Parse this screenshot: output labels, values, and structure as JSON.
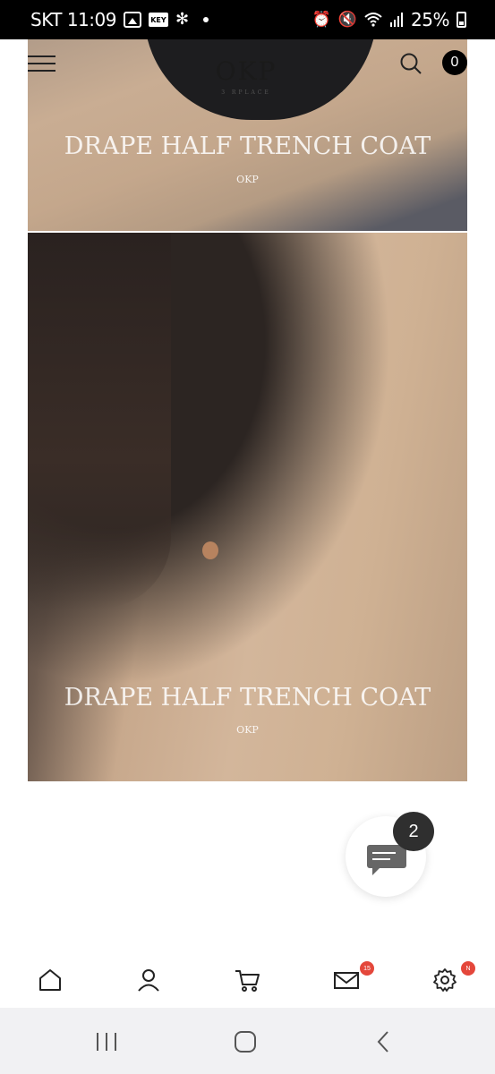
{
  "status_bar": {
    "carrier_time": "SKT 11:09",
    "key_label": "KEY",
    "battery": "25%",
    "icons": [
      "gallery-icon",
      "key-icon",
      "fan-icon",
      "dot-icon",
      "alarm-icon",
      "mute-icon",
      "wifi-icon",
      "signal-icon",
      "battery-icon"
    ]
  },
  "header": {
    "logo": "OKP",
    "logo_sub": "3 RPLACE",
    "cart_count": "0"
  },
  "products": [
    {
      "title": "DRAPE HALF TRENCH COAT",
      "brand": "OKP"
    },
    {
      "title": "DRAPE HALF TRENCH COAT",
      "brand": "OKP"
    }
  ],
  "chat": {
    "badge_count": "2"
  },
  "bottom_nav": {
    "mail_badge": "15",
    "settings_badge": "N",
    "items": [
      "home-icon",
      "user-icon",
      "cart-icon",
      "mail-icon",
      "settings-icon"
    ]
  },
  "colors": {
    "accent_badge": "#e4473b",
    "header_badge": "#000000"
  }
}
